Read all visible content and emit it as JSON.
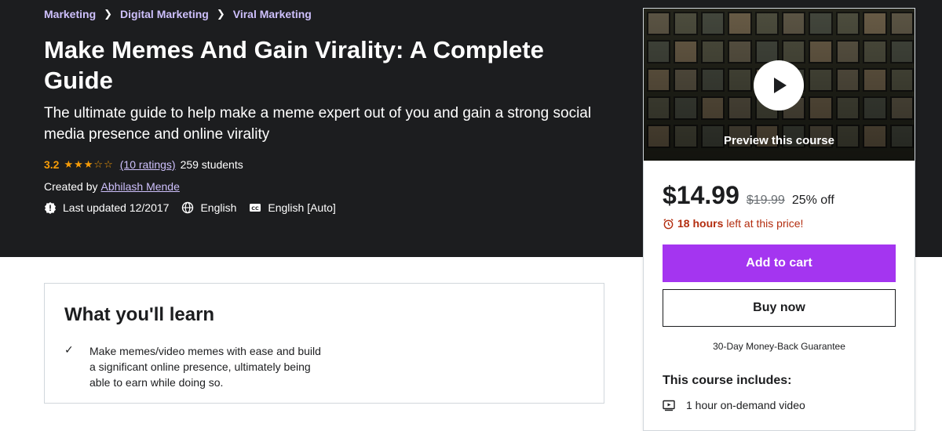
{
  "breadcrumb": [
    "Marketing",
    "Digital Marketing",
    "Viral Marketing"
  ],
  "course": {
    "title": "Make Memes And Gain Virality: A Complete Guide",
    "subtitle": "The ultimate guide to help make a meme expert out of you and gain a strong social media presence and online virality",
    "rating": "3.2",
    "stars_filled": 3,
    "stars_total": 5,
    "stars_display": "★★★☆☆",
    "ratings_link": "(10 ratings)",
    "students": "259 students",
    "created_by_label": "Created by",
    "author": "Abhilash Mende",
    "last_updated": "Last updated 12/2017",
    "language": "English",
    "captions": "English [Auto]"
  },
  "learn": {
    "title": "What you'll learn",
    "items": [
      "Make memes/video memes with ease and build a significant online presence, ultimately being able to earn while doing so."
    ]
  },
  "sidebar": {
    "preview_label": "Preview this course",
    "price": "$14.99",
    "original_price": "$19.99",
    "discount": "25% off",
    "timer_bold": "18 hours",
    "timer_rest": "left at this price!",
    "add_to_cart": "Add to cart",
    "buy_now": "Buy now",
    "guarantee": "30-Day Money-Back Guarantee",
    "includes_title": "This course includes:",
    "includes": [
      "1 hour on-demand video"
    ]
  },
  "colors": {
    "hero_bg": "#1c1d1f",
    "link_purple": "#cec0fc",
    "star_orange": "#f69c08",
    "cart_purple": "#a435f0",
    "timer_red": "#b32d0f"
  },
  "icons": [
    "alert-icon",
    "globe-icon",
    "closed-caption-icon",
    "check-icon",
    "play-icon",
    "alarm-clock-icon",
    "video-icon"
  ]
}
